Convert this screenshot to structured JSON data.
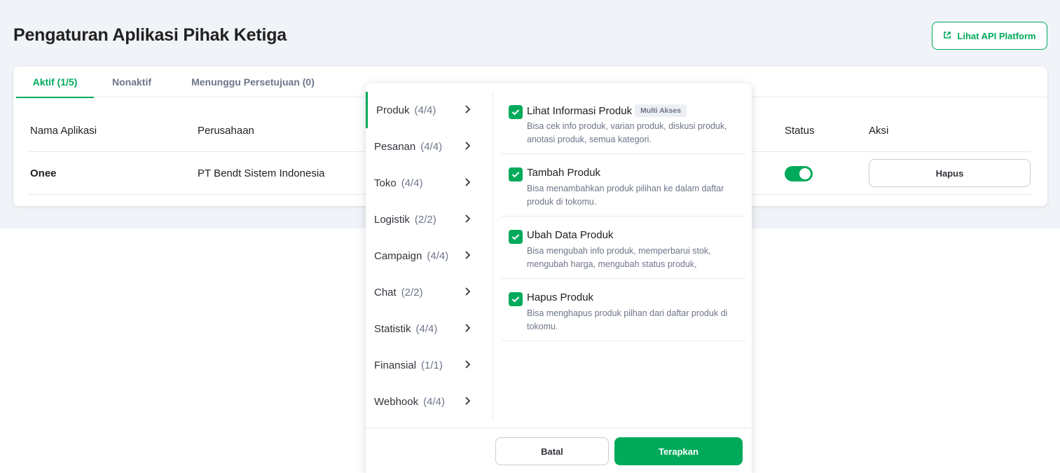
{
  "page": {
    "title": "Pengaturan Aplikasi Pihak Ketiga",
    "api_button_label": "Lihat API Platform"
  },
  "tabs": [
    {
      "label": "Aktif (1/5)",
      "active": true
    },
    {
      "label": "Nonaktif",
      "active": false
    },
    {
      "label": "Menunggu Persetujuan (0)",
      "active": false
    }
  ],
  "table": {
    "headers": {
      "app_name": "Nama Aplikasi",
      "company": "Perusahaan",
      "status": "Status",
      "action": "Aksi"
    },
    "rows": [
      {
        "app_name": "Onee",
        "company": "PT Bendt Sistem Indonesia",
        "status_on": true,
        "action_label": "Hapus"
      }
    ]
  },
  "popover": {
    "categories": [
      {
        "name": "Produk",
        "count": "(4/4)",
        "active": true
      },
      {
        "name": "Pesanan",
        "count": "(4/4)",
        "active": false
      },
      {
        "name": "Toko",
        "count": "(4/4)",
        "active": false
      },
      {
        "name": "Logistik",
        "count": "(2/2)",
        "active": false
      },
      {
        "name": "Campaign",
        "count": "(4/4)",
        "active": false
      },
      {
        "name": "Chat",
        "count": "(2/2)",
        "active": false
      },
      {
        "name": "Statistik",
        "count": "(4/4)",
        "active": false
      },
      {
        "name": "Finansial",
        "count": "(1/1)",
        "active": false
      },
      {
        "name": "Webhook",
        "count": "(4/4)",
        "active": false
      }
    ],
    "permissions": [
      {
        "title": "Lihat Informasi Produk",
        "badge": "Multi Akses",
        "desc": "Bisa cek info produk, varian produk, diskusi produk, anotasi produk, semua kategori.",
        "checked": true
      },
      {
        "title": "Tambah Produk",
        "badge": "",
        "desc": "Bisa menambahkan produk pilihan ke dalam daftar produk di tokomu.",
        "checked": true
      },
      {
        "title": "Ubah Data Produk",
        "badge": "",
        "desc": "Bisa mengubah info produk, memperbarui stok, mengubah harga, mengubah status produk,",
        "checked": true
      },
      {
        "title": "Hapus Produk",
        "badge": "",
        "desc": "Bisa menghapus produk pilhan dari daftar produk di tokomu.",
        "checked": true
      }
    ],
    "cancel_label": "Batal",
    "apply_label": "Terapkan"
  },
  "colors": {
    "accent": "#00aa5b",
    "background": "#f0f3f7",
    "muted_text": "#6d7588"
  }
}
